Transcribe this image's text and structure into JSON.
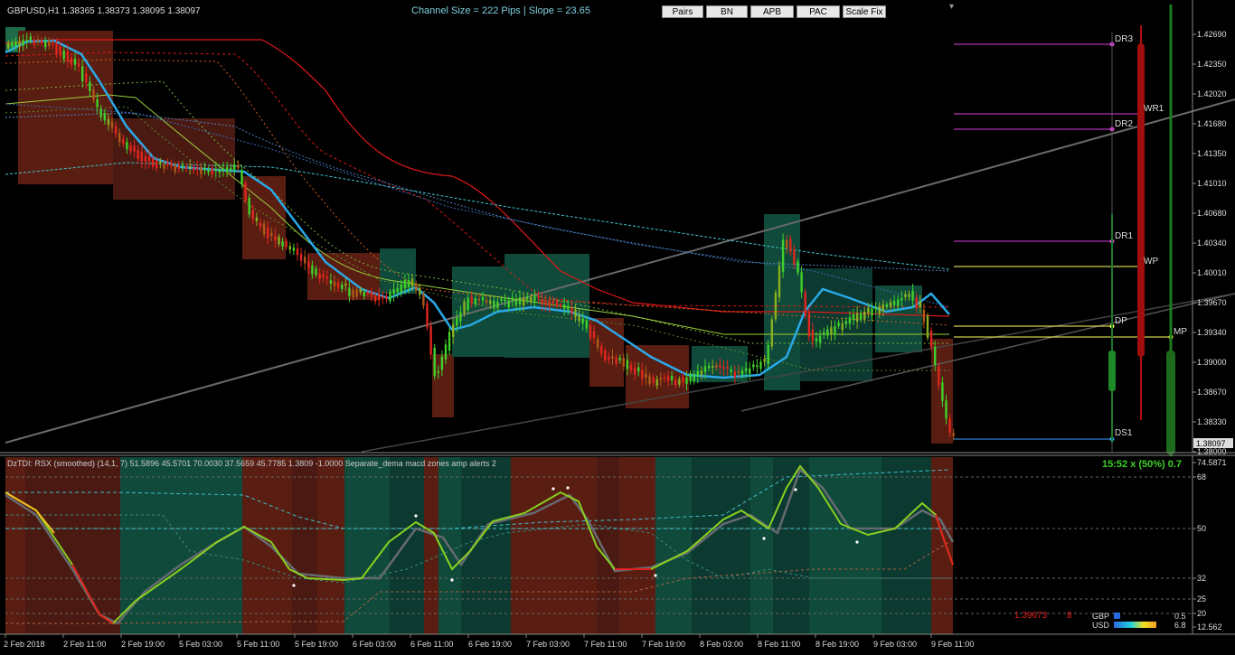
{
  "header": {
    "symbol_info": "GBPUSD,H1  1.38365 1.38373 1.38095 1.38097",
    "channel_info": "Channel Size = 222 Pips  |  Slope = 23.65",
    "buttons": [
      "Pairs",
      "BN",
      "APB",
      "PAC",
      "Scale Fix"
    ]
  },
  "price_axis": {
    "ticks": [
      "1.42690",
      "1.42350",
      "1.42020",
      "1.41680",
      "1.41350",
      "1.41010",
      "1.40680",
      "1.40340",
      "1.40010",
      "1.39670",
      "1.39340",
      "1.39000",
      "1.38670",
      "1.38330",
      "1.38000"
    ],
    "current_price": "1.38097"
  },
  "pivot_levels": {
    "DR3": "DR3",
    "WR1": "WR1",
    "DR2": "DR2",
    "DR1": "DR1",
    "WP": "WP",
    "DP": "DP",
    "MP": "MP",
    "DS1": "DS1"
  },
  "indicator": {
    "label": "DzTDI:  RSX (smoothed) (14,1, 7) 51.5896 45.5701 70.0030 37.5659 45.7785 1.3809 -1.0000  Separate_dema macd zones amp alerts 2",
    "timer_text": "15:52 x (50%) 0.7",
    "ticks": [
      "74.5871",
      "68",
      "50",
      "32",
      "25",
      "20",
      "12.562"
    ],
    "price_readout": "1.39673",
    "price_readout_suffix": "8",
    "currency_strength": [
      {
        "name": "GBP",
        "value": "0.5"
      },
      {
        "name": "USD",
        "value": "6.8"
      }
    ]
  },
  "time_axis": {
    "ticks": [
      "2 Feb 2018",
      "2 Feb 11:00",
      "2 Feb 19:00",
      "5 Feb 03:00",
      "5 Feb 11:00",
      "5 Feb 19:00",
      "6 Feb 03:00",
      "6 Feb 11:00",
      "6 Feb 19:00",
      "7 Feb 03:00",
      "7 Feb 11:00",
      "7 Feb 19:00",
      "8 Feb 03:00",
      "8 Feb 11:00",
      "8 Feb 19:00",
      "9 Feb 03:00",
      "9 Feb 11:00"
    ]
  },
  "colors": {
    "bull_candle": "#3fd12a",
    "bear_candle": "#e0261e",
    "bull_zone": "#0c4a3a",
    "bear_zone": "#5a1d12",
    "ma_blue": "#29a9e8",
    "pivot_magenta": "#e040e0",
    "pivot_yellow": "#ffff40"
  }
}
